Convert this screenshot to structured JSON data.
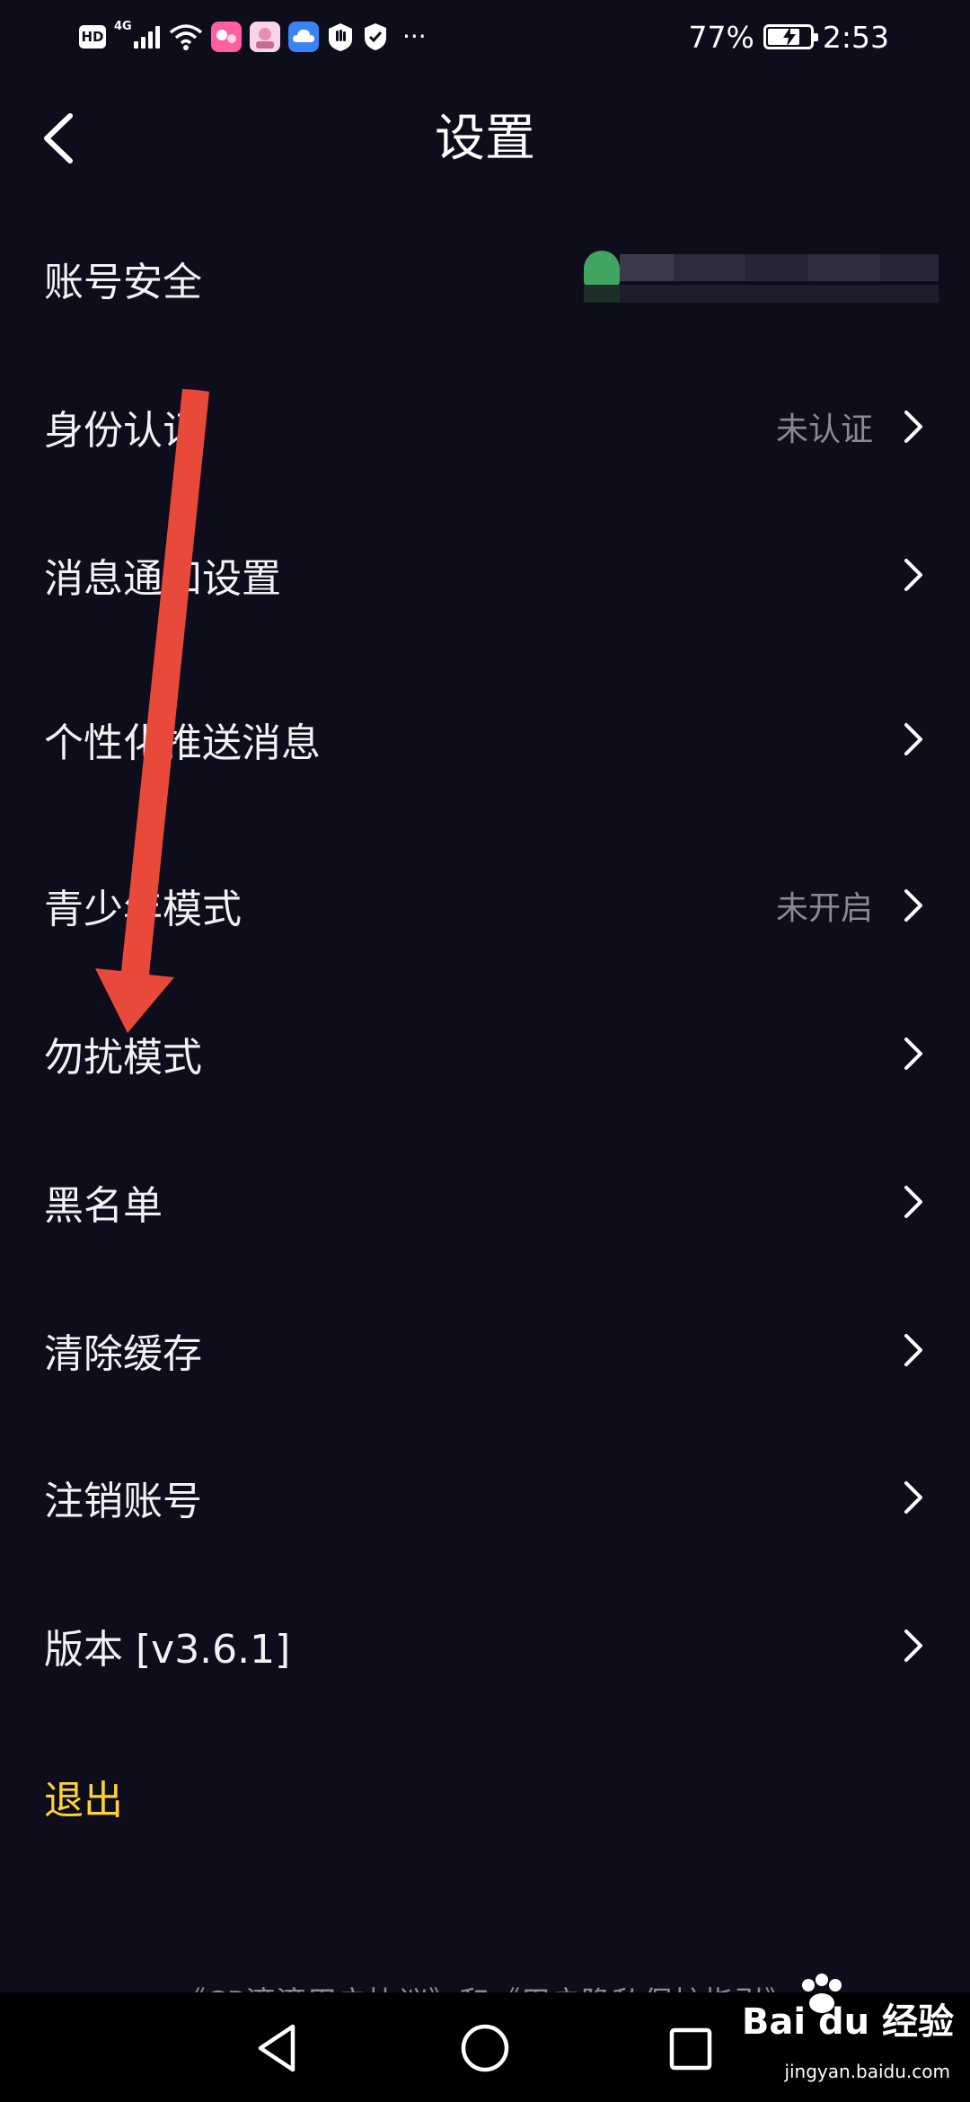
{
  "status_bar": {
    "hd_label": "HD",
    "network_label": "4G",
    "battery_text": "77%",
    "battery_level": 0.77,
    "time": "2:53",
    "overflow_dots": "···"
  },
  "header": {
    "title": "设置"
  },
  "settings": {
    "items": [
      {
        "label": "账号安全",
        "value": ""
      },
      {
        "label": "身份认证",
        "value": "未认证"
      },
      {
        "label": "消息通知设置",
        "value": ""
      },
      {
        "label": "个性化推送消息",
        "value": ""
      },
      {
        "label": "青少年模式",
        "value": "未开启"
      },
      {
        "label": "勿扰模式",
        "value": ""
      },
      {
        "label": "黑名单",
        "value": ""
      },
      {
        "label": "清除缓存",
        "value": ""
      },
      {
        "label": "注销账号",
        "value": ""
      },
      {
        "label": "版本 [v3.6.1]",
        "value": ""
      }
    ],
    "logout_label": "退出"
  },
  "footer": {
    "agreement_text": "《CP滴滴用户协议》和《用户隐私保护指引》"
  },
  "watermark": {
    "logo_text": "Bai du 经验",
    "url": "jingyan.baidu.com"
  },
  "colors": {
    "background": "#0d0d1c",
    "logout": "#ffd23a",
    "annotation_arrow": "#e9493b",
    "secondary_text": "#8a8a96"
  }
}
